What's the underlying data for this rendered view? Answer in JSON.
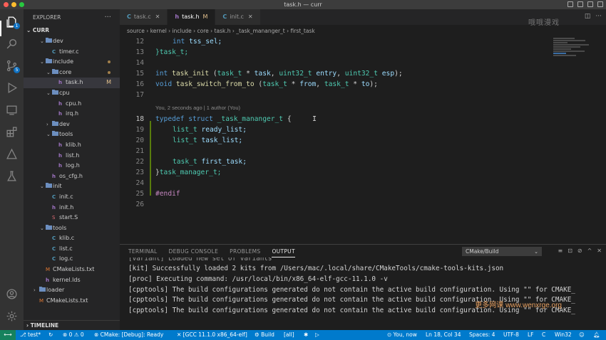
{
  "window": {
    "title": "task.h — curr"
  },
  "sidebar": {
    "title": "EXPLORER",
    "root": "CURR",
    "timeline": "TIMELINE",
    "tree": [
      {
        "name": "dev",
        "type": "folder",
        "depth": 1,
        "open": true
      },
      {
        "name": "timer.c",
        "type": "c",
        "depth": 2
      },
      {
        "name": "include",
        "type": "folder",
        "depth": 1,
        "open": true,
        "dot": true
      },
      {
        "name": "core",
        "type": "folder",
        "depth": 2,
        "open": true,
        "dot": true
      },
      {
        "name": "task.h",
        "type": "h",
        "depth": 3,
        "selected": true,
        "mark": "M"
      },
      {
        "name": "cpu",
        "type": "folder",
        "depth": 2,
        "open": true
      },
      {
        "name": "cpu.h",
        "type": "h",
        "depth": 3
      },
      {
        "name": "irq.h",
        "type": "h",
        "depth": 3
      },
      {
        "name": "dev",
        "type": "folder",
        "depth": 2,
        "open": false
      },
      {
        "name": "tools",
        "type": "folder",
        "depth": 2,
        "open": true
      },
      {
        "name": "klib.h",
        "type": "h",
        "depth": 3
      },
      {
        "name": "list.h",
        "type": "h",
        "depth": 3
      },
      {
        "name": "log.h",
        "type": "h",
        "depth": 3
      },
      {
        "name": "os_cfg.h",
        "type": "h",
        "depth": 2
      },
      {
        "name": "init",
        "type": "folder",
        "depth": 1,
        "open": true
      },
      {
        "name": "init.c",
        "type": "c",
        "depth": 2
      },
      {
        "name": "init.h",
        "type": "h",
        "depth": 2
      },
      {
        "name": "start.S",
        "type": "s",
        "depth": 2
      },
      {
        "name": "tools",
        "type": "folder",
        "depth": 1,
        "open": true
      },
      {
        "name": "klib.c",
        "type": "c",
        "depth": 2
      },
      {
        "name": "list.c",
        "type": "c",
        "depth": 2
      },
      {
        "name": "log.c",
        "type": "c",
        "depth": 2
      },
      {
        "name": "CMakeLists.txt",
        "type": "m",
        "depth": 1
      },
      {
        "name": "kernel.lds",
        "type": "h",
        "depth": 1
      },
      {
        "name": "loader",
        "type": "folder",
        "depth": 0,
        "open": false
      },
      {
        "name": "CMakeLists.txt",
        "type": "m",
        "depth": 0
      }
    ]
  },
  "tabs": [
    {
      "label": "task.c",
      "icon": "C",
      "active": false
    },
    {
      "label": "task.h",
      "icon": "h",
      "active": true,
      "mark": "M"
    },
    {
      "label": "init.c",
      "icon": "C",
      "active": false
    }
  ],
  "breadcrumbs": [
    "source",
    "kernel",
    "include",
    "core",
    "task.h",
    "_task_mananger_t",
    "first_task"
  ],
  "blame": "You, 2 seconds ago | 1 author (You)",
  "code": {
    "l12": "12",
    "l13": "13",
    "l14": "14",
    "l15": "15",
    "l16": "16",
    "l17": "17",
    "l18": "18",
    "l19": "19",
    "l20": "20",
    "l21": "21",
    "l22": "22",
    "l23": "23",
    "l24": "24",
    "l25": "25",
    "l26": "26",
    "c12a": "int",
    "c12b": "tss_sel;",
    "c13": "}task_t;",
    "c15a": "int",
    "c15b": "task_init",
    "c15c": " (",
    "c15d": "task_t",
    "c15e": " * ",
    "c15f": "task",
    "c15g": ", ",
    "c15h": "uint32_t",
    "c15i": " ",
    "c15j": "entry",
    "c15k": ", ",
    "c15l": "uint32_t",
    "c15m": " ",
    "c15n": "esp",
    "c15o": ");",
    "c16a": "void",
    "c16b": "task_switch_from_to",
    "c16c": " (",
    "c16d": "task_t",
    "c16e": " * ",
    "c16f": "from",
    "c16g": ", ",
    "c16h": "task_t",
    "c16i": " * ",
    "c16j": "to",
    "c16k": ");",
    "c18a": "typedef",
    "c18b": "struct",
    "c18c": "_task_mananger_t",
    "c18d": " {",
    "c19a": "list_t",
    "c19b": "ready_list;",
    "c20a": "list_t",
    "c20b": "task_list;",
    "c22a": "task_t",
    "c22b": "first_task;",
    "c23a": "}",
    "c23b": "task_manager_t;",
    "c25": "#endif"
  },
  "watermark_top": "哦哦漫戏",
  "panel": {
    "tabs": [
      "TERMINAL",
      "DEBUG CONSOLE",
      "PROBLEMS",
      "OUTPUT"
    ],
    "selector": "CMake/Build",
    "lines": [
      "[variant] Loaded new set of variants",
      "[kit] Successfully loaded 2 kits from /Users/mac/.local/share/CMakeTools/cmake-tools-kits.json",
      "[proc] Executing command: /usr/local/bin/x86_64-elf-gcc-11.1.0 -v",
      "[cpptools] The build configurations generated do not contain the active build configuration. Using \"\" for CMAKE_",
      "[cpptools] The build configurations generated do not contain the active build configuration. Using \"\" for CMAKE_",
      "[cpptools] The build configurations generated do not contain the active build configuration. Using \"\" for CMAKE_"
    ],
    "watermark": "更多网课 www.wenxrge.org"
  },
  "status": {
    "branch": "test*",
    "problems": "⊗ 0 ⚠ 0",
    "cmake": "CMake: [Debug]: Ready",
    "kit": "[GCC 11.1.0 x86_64-elf]",
    "build": "Build",
    "target": "[all]",
    "blame": "You, now",
    "position": "Ln 18, Col 34",
    "spaces": "Spaces: 4",
    "encoding": "UTF-8",
    "eol": "LF",
    "lang": "C",
    "platform": "Win32"
  },
  "colors": {
    "accent": "#007acc",
    "activity": "#333333",
    "sidebar": "#252526",
    "editor": "#1e1e1e"
  }
}
